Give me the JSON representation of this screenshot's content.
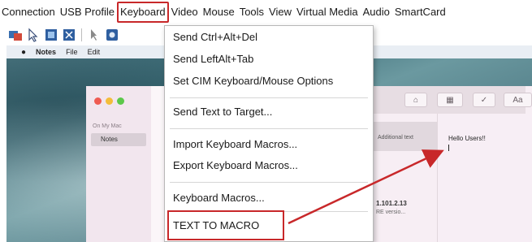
{
  "menubar": {
    "items": [
      {
        "label": "Connection"
      },
      {
        "label": "USB Profile"
      },
      {
        "label": "Keyboard",
        "active": true
      },
      {
        "label": "Video"
      },
      {
        "label": "Mouse"
      },
      {
        "label": "Tools"
      },
      {
        "label": "View"
      },
      {
        "label": "Virtual Media"
      },
      {
        "label": "Audio"
      },
      {
        "label": "SmartCard"
      }
    ]
  },
  "toolbar": {
    "icons": [
      "connect-icon",
      "pointer-icon",
      "fullscreen-icon",
      "fit-screen-icon",
      "mouse-sync-icon",
      "settings-icon"
    ]
  },
  "remote": {
    "mac_menu": {
      "apple": "",
      "app": "Notes",
      "file": "File",
      "edit": "Edit"
    },
    "notes": {
      "sidebar_caption": "On My Mac",
      "sidebar_selected": "Notes",
      "list_row1": "Additional text",
      "list_row2_title": "1.101.2.13",
      "list_row2_sub": "RE versio...",
      "editor_text": "Hello Users!!"
    }
  },
  "dropdown": {
    "send_ctrl_alt_del": "Send Ctrl+Alt+Del",
    "send_leftalt_tab": "Send LeftAlt+Tab",
    "set_cim": "Set CIM Keyboard/Mouse Options",
    "send_text": "Send Text to Target...",
    "import_macros": "Import Keyboard Macros...",
    "export_macros": "Export Keyboard Macros...",
    "keyboard_macros": "Keyboard Macros...",
    "text_to_macro": "TEXT TO MACRO"
  },
  "colors": {
    "highlight": "#c8282a",
    "arrow": "#c8282a"
  }
}
